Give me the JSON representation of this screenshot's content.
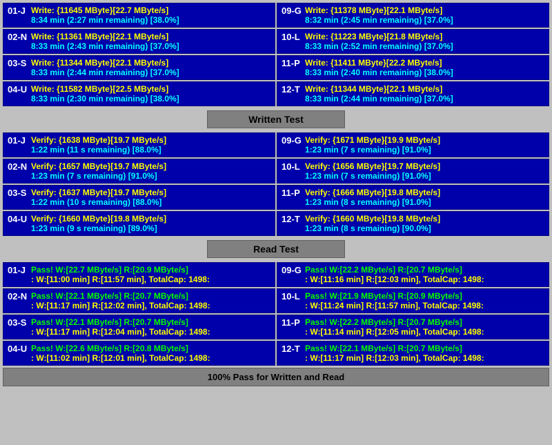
{
  "write_section": {
    "cells": [
      {
        "label": "01-J",
        "line1": "Write: {11645 MByte}[22.7 MByte/s]",
        "line2": "8:34 min (2:27 min remaining)  [38.0%]"
      },
      {
        "label": "09-G",
        "line1": "Write: {11378 MByte}[22.1 MByte/s]",
        "line2": "8:32 min (2:45 min remaining)  [37.0%]"
      },
      {
        "label": "02-N",
        "line1": "Write: {11361 MByte}[22.1 MByte/s]",
        "line2": "8:33 min (2:43 min remaining)  [37.0%]"
      },
      {
        "label": "10-L",
        "line1": "Write: {11223 MByte}[21.8 MByte/s]",
        "line2": "8:33 min (2:52 min remaining)  [37.0%]"
      },
      {
        "label": "03-S",
        "line1": "Write: {11344 MByte}[22.1 MByte/s]",
        "line2": "8:33 min (2:44 min remaining)  [37.0%]"
      },
      {
        "label": "11-P",
        "line1": "Write: {11411 MByte}[22.2 MByte/s]",
        "line2": "8:33 min (2:40 min remaining)  [38.0%]"
      },
      {
        "label": "04-U",
        "line1": "Write: {11582 MByte}[22.5 MByte/s]",
        "line2": "8:33 min (2:30 min remaining)  [38.0%]"
      },
      {
        "label": "12-T",
        "line1": "Write: {11344 MByte}[22.1 MByte/s]",
        "line2": "8:33 min (2:44 min remaining)  [37.0%]"
      }
    ],
    "header": "Written Test"
  },
  "verify_section": {
    "cells": [
      {
        "label": "01-J",
        "line1": "Verify: {1638 MByte}[19.7 MByte/s]",
        "line2": "1:22 min (11 s remaining)   [88.0%]"
      },
      {
        "label": "09-G",
        "line1": "Verify: {1671 MByte}[19.9 MByte/s]",
        "line2": "1:23 min (7 s remaining)   [91.0%]"
      },
      {
        "label": "02-N",
        "line1": "Verify: {1657 MByte}[19.7 MByte/s]",
        "line2": "1:23 min (7 s remaining)   [91.0%]"
      },
      {
        "label": "10-L",
        "line1": "Verify: {1656 MByte}[19.7 MByte/s]",
        "line2": "1:23 min (7 s remaining)   [91.0%]"
      },
      {
        "label": "03-S",
        "line1": "Verify: {1637 MByte}[19.7 MByte/s]",
        "line2": "1:22 min (10 s remaining)   [88.0%]"
      },
      {
        "label": "11-P",
        "line1": "Verify: {1666 MByte}[19.8 MByte/s]",
        "line2": "1:23 min (8 s remaining)   [91.0%]"
      },
      {
        "label": "04-U",
        "line1": "Verify: {1660 MByte}[19.8 MByte/s]",
        "line2": "1:23 min (9 s remaining)   [89.0%]"
      },
      {
        "label": "12-T",
        "line1": "Verify: {1660 MByte}[19.8 MByte/s]",
        "line2": "1:23 min (8 s remaining)   [90.0%]"
      }
    ],
    "header": "Read Test"
  },
  "pass_section": {
    "cells": [
      {
        "label": "01-J",
        "line1": "Pass! W:[22.7 MByte/s] R:[20.9 MByte/s]",
        "line2": ": W:[11:00 min] R:[11:57 min], TotalCap: 1498:"
      },
      {
        "label": "09-G",
        "line1": "Pass! W:[22.2 MByte/s] R:[20.7 MByte/s]",
        "line2": ": W:[11:16 min] R:[12:03 min], TotalCap: 1498:"
      },
      {
        "label": "02-N",
        "line1": "Pass! W:[22.1 MByte/s] R:[20.7 MByte/s]",
        "line2": ": W:[11:17 min] R:[12:02 min], TotalCap: 1498:"
      },
      {
        "label": "10-L",
        "line1": "Pass! W:[21.9 MByte/s] R:[20.9 MByte/s]",
        "line2": ": W:[11:24 min] R:[11:57 min], TotalCap: 1498:"
      },
      {
        "label": "03-S",
        "line1": "Pass! W:[22.1 MByte/s] R:[20.7 MByte/s]",
        "line2": ": W:[11:17 min] R:[12:04 min], TotalCap: 1498:"
      },
      {
        "label": "11-P",
        "line1": "Pass! W:[22.2 MByte/s] R:[20.7 MByte/s]",
        "line2": ": W:[11:14 min] R:[12:05 min], TotalCap: 1498:"
      },
      {
        "label": "04-U",
        "line1": "Pass! W:[22.6 MByte/s] R:[20.8 MByte/s]",
        "line2": ": W:[11:02 min] R:[12:01 min], TotalCap: 1498:"
      },
      {
        "label": "12-T",
        "line1": "Pass! W:[22.1 MByte/s] R:[20.7 MByte/s]",
        "line2": ": W:[11:17 min] R:[12:03 min], TotalCap: 1498:"
      }
    ]
  },
  "footer": "100% Pass for Written and Read"
}
